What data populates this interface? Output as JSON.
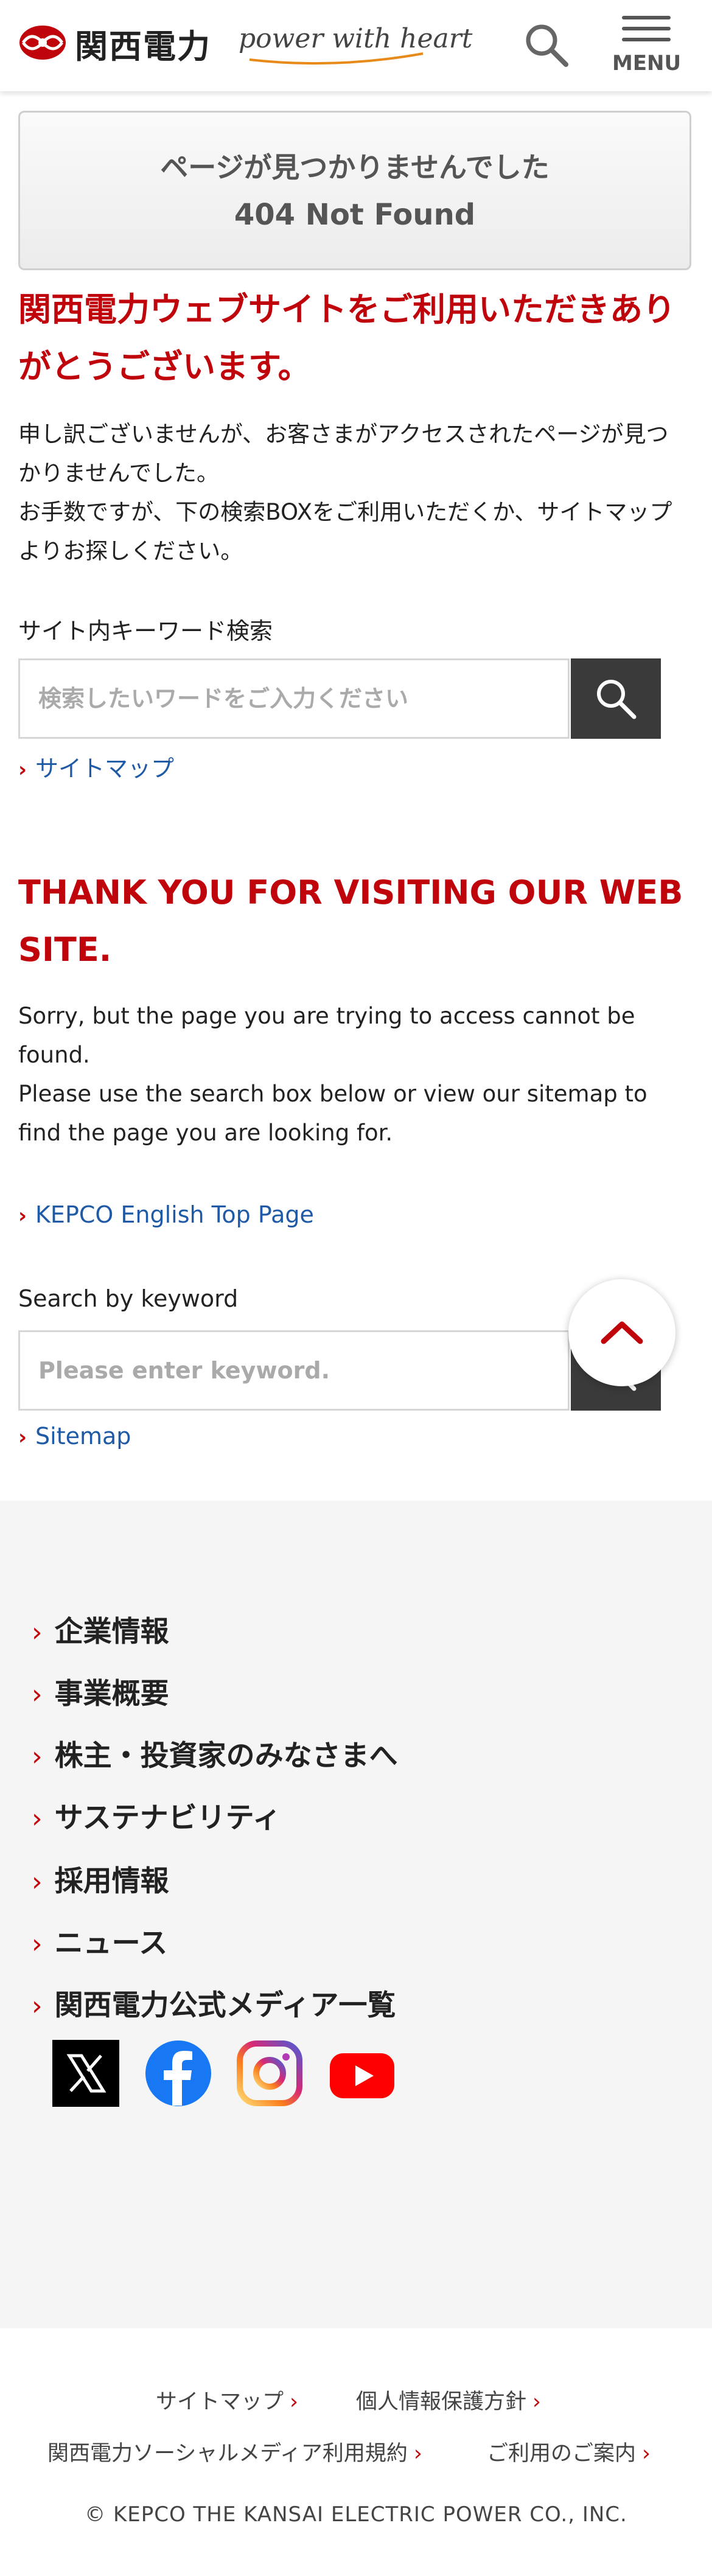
{
  "header": {
    "logo_text": "関西電力",
    "tagline": "power with heart",
    "menu_label": "MENU",
    "brand_color": "#c0040c"
  },
  "not_found": {
    "line1": "ページが見つかりませんでした",
    "line2": "404 Not Found"
  },
  "jp": {
    "heading_line1": "関西電力ウェブサイトをご利用いただきあり",
    "heading_line2": "がとうございます。",
    "para_lines": [
      "申し訳ございませんが、お客さまがアクセスされたページが見つ",
      "かりませんでした。",
      "お手数ですが、下の検索BOXをご利用いただくか、サイトマップ",
      "よりお探しください。"
    ],
    "search_label": "サイト内キーワード検索",
    "search_placeholder": "検索したいワードをご入力ください",
    "sitemap_link": "サイトマップ"
  },
  "en": {
    "heading_line1": "THANK YOU FOR VISITING OUR WEB",
    "heading_line2": "SITE.",
    "para_lines": [
      "Sorry, but the page you are trying to access cannot be",
      "found.",
      "Please use the search box below or view our sitemap to",
      "find the page you are looking for."
    ],
    "top_page_link": "KEPCO English Top Page",
    "search_label": "Search by keyword",
    "search_placeholder": "Please enter keyword.",
    "sitemap_link": "Sitemap"
  },
  "footer_nav": {
    "items": [
      "企業情報",
      "事業概要",
      "株主・投資家のみなさまへ",
      "サステナビリティ",
      "採用情報",
      "ニュース",
      "関西電力公式メディア一覧"
    ],
    "social": [
      "x-icon",
      "facebook-icon",
      "instagram-icon",
      "youtube-icon"
    ]
  },
  "footer": {
    "links": [
      "サイトマップ",
      "個人情報保護方針",
      "関西電力ソーシャルメディア利用規約",
      "ご利用のご案内"
    ],
    "copyright": "© KEPCO THE KANSAI ELECTRIC POWER CO., INC."
  }
}
